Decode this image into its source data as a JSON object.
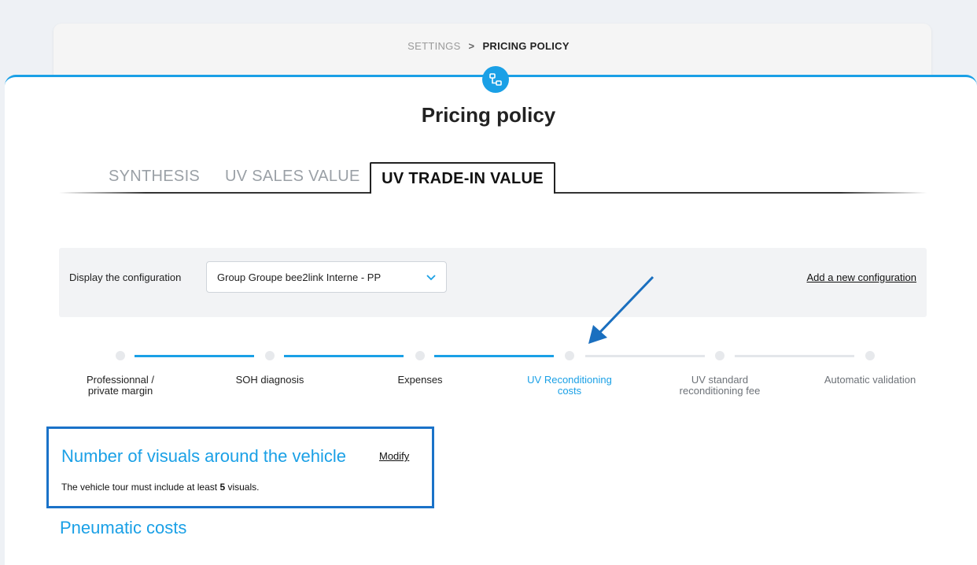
{
  "breadcrumb": {
    "parent": "SETTINGS",
    "current": "PRICING POLICY"
  },
  "page_title": "Pricing policy",
  "tabs": [
    {
      "label": "SYNTHESIS",
      "active": false
    },
    {
      "label": "UV SALES VALUE",
      "active": false
    },
    {
      "label": "UV TRADE-IN VALUE",
      "active": true
    }
  ],
  "config": {
    "label": "Display the configuration",
    "selected": "Group Groupe bee2link Interne - PP",
    "add_link": "Add a new configuration"
  },
  "steps": [
    {
      "label_lines": [
        "Professionnal /",
        "private margin"
      ],
      "state": "done"
    },
    {
      "label_lines": [
        "SOH diagnosis"
      ],
      "state": "done"
    },
    {
      "label_lines": [
        "Expenses"
      ],
      "state": "done"
    },
    {
      "label_lines": [
        "UV Reconditioning",
        "costs"
      ],
      "state": "active"
    },
    {
      "label_lines": [
        "UV standard",
        "reconditioning fee"
      ],
      "state": "todo"
    },
    {
      "label_lines": [
        "Automatic validation"
      ],
      "state": "todo"
    }
  ],
  "section1": {
    "title": "Number of visuals around the vehicle",
    "modify": "Modify",
    "desc_prefix": "The vehicle tour must include at least ",
    "desc_value": "5",
    "desc_suffix": " visuals."
  },
  "section2": {
    "title": "Pneumatic costs"
  },
  "colors": {
    "accent": "#1aa0e6",
    "highlight_box": "#1a72c8",
    "arrow": "#1a6fbf"
  }
}
